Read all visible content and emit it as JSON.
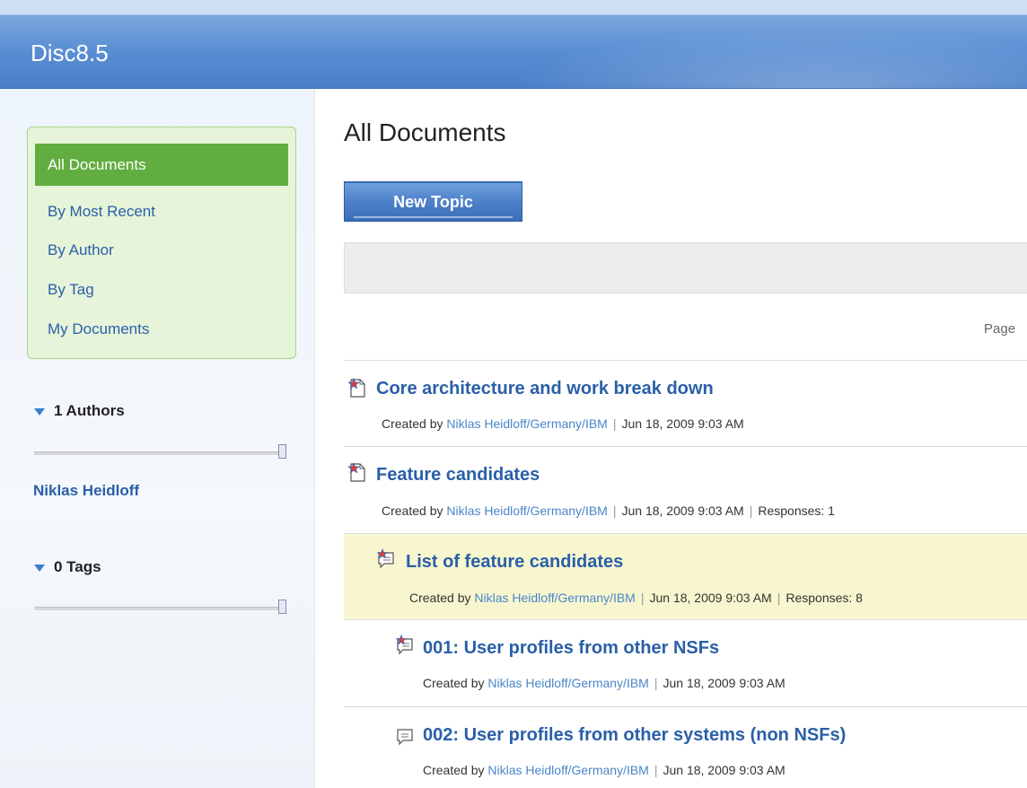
{
  "app": {
    "title": "Disc8.5"
  },
  "sidebar": {
    "nav": [
      {
        "label": "All Documents",
        "active": true
      },
      {
        "label": "By Most Recent",
        "active": false
      },
      {
        "label": "By Author",
        "active": false
      },
      {
        "label": "By Tag",
        "active": false
      },
      {
        "label": "My Documents",
        "active": false
      }
    ],
    "authors_section": {
      "label": "1 Authors",
      "authors": [
        "Niklas Heidloff"
      ]
    },
    "tags_section": {
      "label": "0 Tags"
    }
  },
  "main": {
    "title": "All Documents",
    "new_topic_label": "New Topic",
    "pager_label": "Page",
    "documents": [
      {
        "icon": "main-topic-icon",
        "title": "Core architecture and work break down",
        "created_label": "Created by",
        "author": "Niklas Heidloff/Germany/IBM",
        "date": "Jun 18, 2009 9:03 AM",
        "responses_label": "",
        "responses": ""
      },
      {
        "icon": "main-topic-icon",
        "title": "Feature candidates",
        "created_label": "Created by",
        "author": "Niklas Heidloff/Germany/IBM",
        "date": "Jun 18, 2009 9:03 AM",
        "responses_label": "Responses:",
        "responses": "1"
      },
      {
        "icon": "response-starred-icon",
        "title": "List of feature candidates",
        "created_label": "Created by",
        "author": "Niklas Heidloff/Germany/IBM",
        "date": "Jun 18, 2009 9:03 AM",
        "responses_label": "Responses:",
        "responses": "8",
        "highlighted": true
      },
      {
        "icon": "response-starred-icon",
        "title": "001: User profiles from other NSFs",
        "created_label": "Created by",
        "author": "Niklas Heidloff/Germany/IBM",
        "date": "Jun 18, 2009 9:03 AM",
        "responses_label": "",
        "responses": ""
      },
      {
        "icon": "response-icon",
        "title": "002: User profiles from other systems (non NSFs)",
        "created_label": "Created by",
        "author": "Niklas Heidloff/Germany/IBM",
        "date": "Jun 18, 2009 9:03 AM",
        "responses_label": "",
        "responses": ""
      }
    ]
  }
}
